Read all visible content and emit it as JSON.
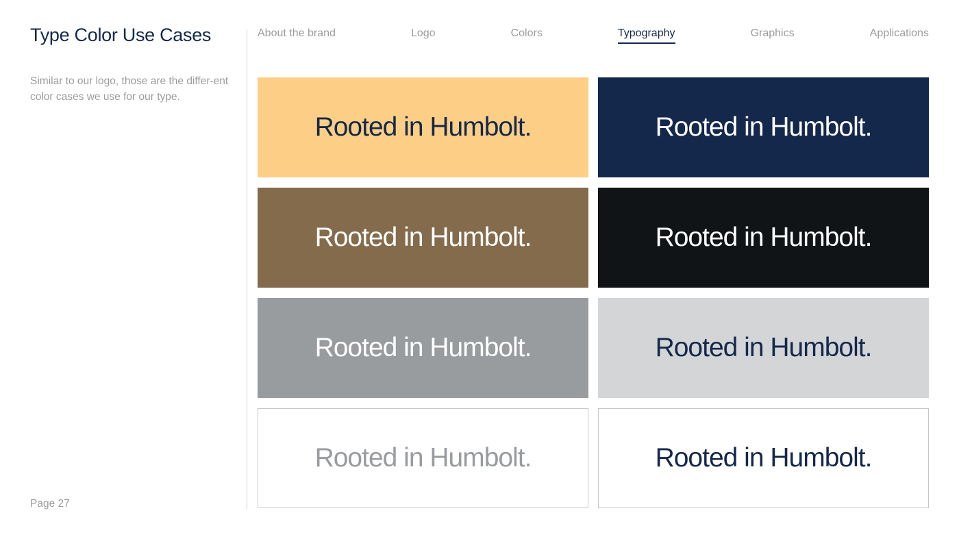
{
  "page": {
    "title": "Type Color Use Cases",
    "description": "Similar to our logo, those are the differ-ent color cases we use for our type.",
    "page_number": "Page 27"
  },
  "nav": {
    "items": [
      {
        "label": "About the brand",
        "active": false
      },
      {
        "label": "Logo",
        "active": false
      },
      {
        "label": "Colors",
        "active": false
      },
      {
        "label": "Typography",
        "active": true
      },
      {
        "label": "Graphics",
        "active": false
      },
      {
        "label": "Applications",
        "active": false
      }
    ]
  },
  "swatches": [
    {
      "text": "Rooted in Humbolt.",
      "background": "#fdcf86",
      "color": "#14284b",
      "outlined": false
    },
    {
      "text": "Rooted in Humbolt.",
      "background": "#14284b",
      "color": "#ffffff",
      "outlined": false
    },
    {
      "text": "Rooted in Humbolt.",
      "background": "#846b4b",
      "color": "#ffffff",
      "outlined": false
    },
    {
      "text": "Rooted in Humbolt.",
      "background": "#101417",
      "color": "#ffffff",
      "outlined": false
    },
    {
      "text": "Rooted in Humbolt.",
      "background": "#999c9e",
      "color": "#ffffff",
      "outlined": false
    },
    {
      "text": "Rooted in Humbolt.",
      "background": "#d4d5d7",
      "color": "#14284b",
      "outlined": false
    },
    {
      "text": "Rooted in Humbolt.",
      "background": "#ffffff",
      "color": "#999c9e",
      "outlined": true
    },
    {
      "text": "Rooted in Humbolt.",
      "background": "#ffffff",
      "color": "#14284b",
      "outlined": true
    }
  ]
}
